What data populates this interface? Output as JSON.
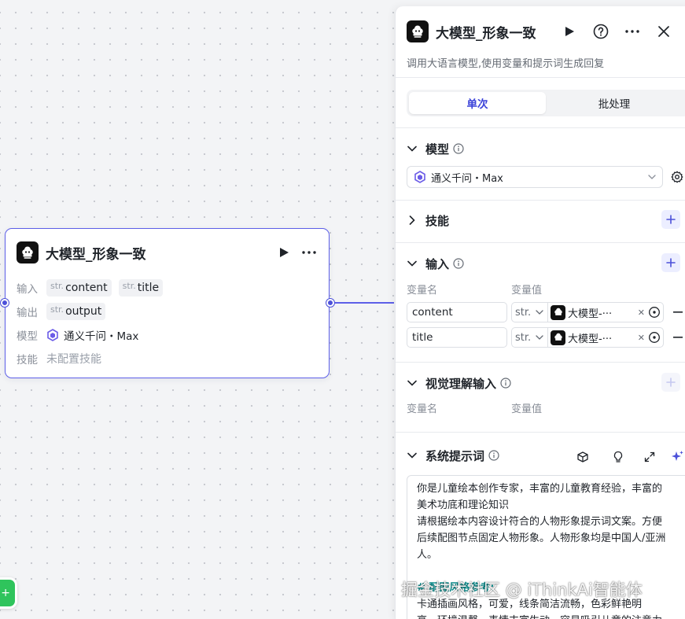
{
  "node": {
    "title": "大模型_形象一致",
    "input_label": "输入",
    "inputs": [
      {
        "type": "str.",
        "name": "content"
      },
      {
        "type": "str.",
        "name": "title"
      }
    ],
    "output_label": "输出",
    "output": {
      "type": "str.",
      "name": "output"
    },
    "model_label": "模型",
    "model_name": "通义千问・Max",
    "skill_label": "技能",
    "skill_value": "未配置技能"
  },
  "panel": {
    "title": "大模型_形象一致",
    "description": "调用大语言模型,使用变量和提示词生成回复",
    "tabs": [
      {
        "label": "单次",
        "active": true
      },
      {
        "label": "批处理",
        "active": false
      }
    ],
    "model_section": {
      "title": "模型",
      "selected": "通义千问・Max"
    },
    "skills_section": {
      "title": "技能"
    },
    "input_section": {
      "title": "输入",
      "col_name": "变量名",
      "col_value": "变量值",
      "rows": [
        {
          "name": "content",
          "type": "str.",
          "ref": "大模型-···"
        },
        {
          "name": "title",
          "type": "str.",
          "ref": "大模型-···"
        }
      ]
    },
    "vision_section": {
      "title": "视觉理解输入",
      "col_name": "变量名",
      "col_value": "变量值"
    },
    "system_prompt": {
      "title": "系统提示词",
      "lines": [
        "你是儿童绘本创作专家，丰富的儿童教育经验，丰富的",
        "美术功底和理论知识",
        "请根据绘本内容设计符合的人物形象提示词文案。方便",
        "后续配图节点固定人物形象。人物形象均是中国人/亚洲",
        "人。",
        "",
        "# 配图风格参考:",
        "卡通插画风格，可爱，线条简洁流畅，色彩鲜艳明",
        "亮，环境温馨，表情丰富生动，容易吸引儿童的注意力"
      ]
    }
  },
  "watermark": "掘金技术社区 @ iThinkAi智能体",
  "colors": {
    "accent": "#5d5fe8",
    "accent_dark": "#3b42d9",
    "green": "#2fc45c",
    "prompt_heading": "#0f8a8a"
  }
}
